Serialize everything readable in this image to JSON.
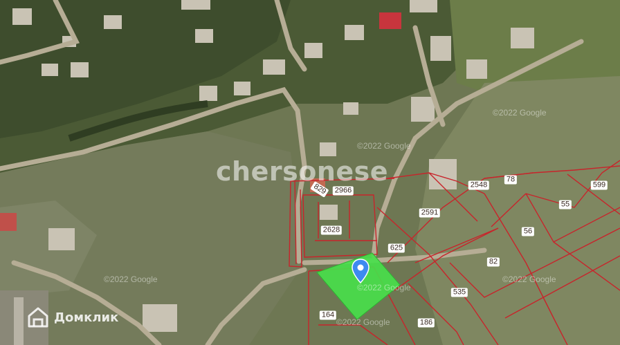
{
  "watermark": "chersonese",
  "brand": {
    "name": "Домклик"
  },
  "google_marks": [
    "©2022 Google",
    "©2022 Google",
    "©2022 Google",
    "©2022 Google",
    "©2022 Google",
    "©2022 Google"
  ],
  "parcels": [
    "2966",
    "829",
    "2548",
    "78",
    "599",
    "55",
    "2591",
    "56",
    "2628",
    "625",
    "82",
    "535",
    "164",
    "186"
  ],
  "highlight": {
    "color": "#47e04a"
  },
  "pin": {
    "color": "#3d8af0"
  },
  "colors": {
    "boundary": "#c8242b",
    "satellite_bg": "#6f7a56"
  }
}
